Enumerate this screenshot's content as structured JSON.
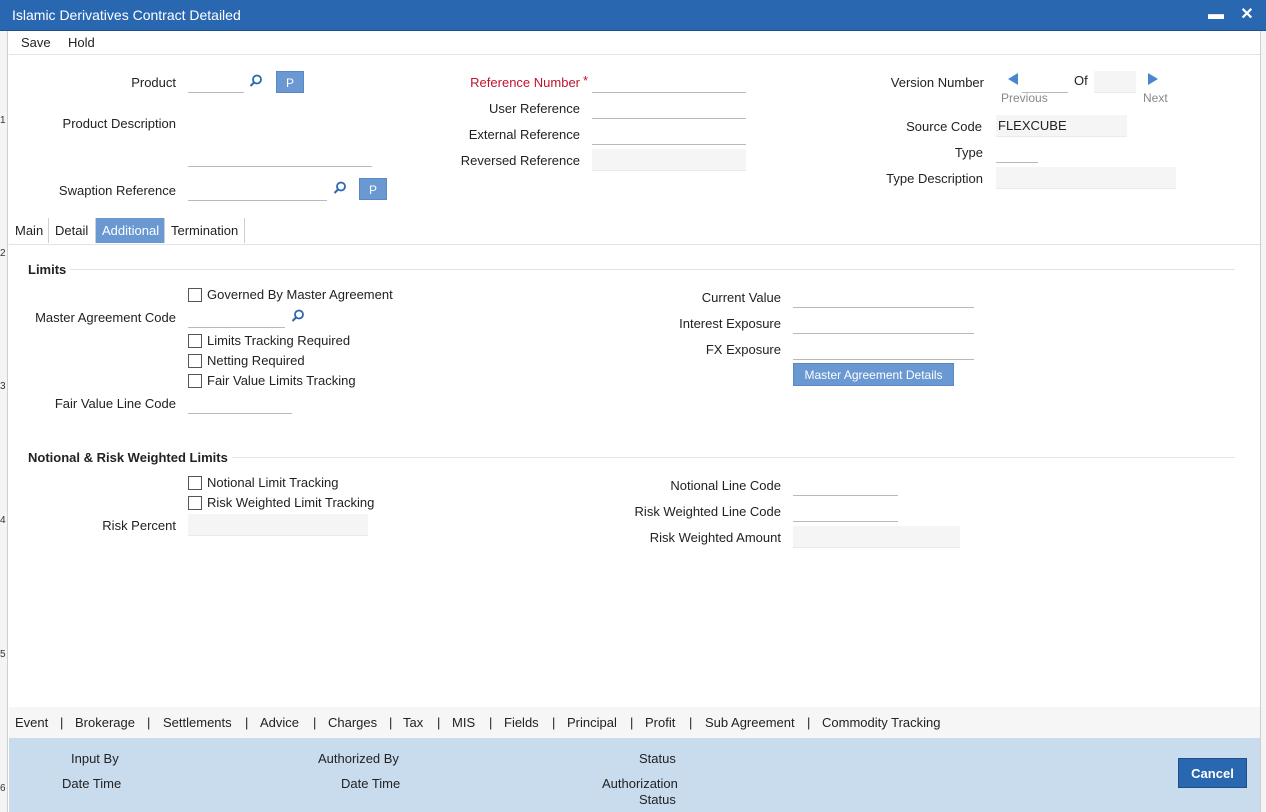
{
  "window": {
    "title": "Islamic Derivatives Contract Detailed"
  },
  "menu": {
    "save": "Save",
    "hold": "Hold"
  },
  "header": {
    "product_label": "Product",
    "product_description_label": "Product Description",
    "swaption_reference_label": "Swaption Reference",
    "p_button": "P",
    "reference_number_label": "Reference Number",
    "required_mark": "*",
    "user_reference_label": "User Reference",
    "external_reference_label": "External Reference",
    "reversed_reference_label": "Reversed Reference",
    "version_number_label": "Version Number",
    "of_label": "Of",
    "previous_label": "Previous",
    "next_label": "Next",
    "source_code_label": "Source Code",
    "source_code_value": "FLEXCUBE",
    "type_label": "Type",
    "type_description_label": "Type Description"
  },
  "tabs": [
    "Main",
    "Detail",
    "Additional",
    "Termination"
  ],
  "active_tab": "Additional",
  "limits": {
    "title": "Limits",
    "governed_by_master_agreement": "Governed By Master Agreement",
    "master_agreement_code_label": "Master Agreement Code",
    "limits_tracking_required": "Limits Tracking Required",
    "netting_required": "Netting Required",
    "fair_value_limits_tracking": "Fair Value Limits Tracking",
    "fair_value_line_code_label": "Fair Value Line Code",
    "current_value_label": "Current Value",
    "interest_exposure_label": "Interest Exposure",
    "fx_exposure_label": "FX Exposure",
    "master_agreement_details_button": "Master Agreement Details"
  },
  "notional": {
    "title": "Notional & Risk Weighted Limits",
    "notional_limit_tracking": "Notional Limit Tracking",
    "risk_weighted_limit_tracking": "Risk Weighted Limit Tracking",
    "risk_percent_label": "Risk Percent",
    "notional_line_code_label": "Notional Line Code",
    "risk_weighted_line_code_label": "Risk Weighted Line Code",
    "risk_weighted_amount_label": "Risk Weighted Amount"
  },
  "bottom_tabs": [
    "Event",
    "Brokerage",
    "Settlements",
    "Advice",
    "Charges",
    "Tax",
    "MIS",
    "Fields",
    "Principal",
    "Profit",
    "Sub Agreement",
    "Commodity Tracking"
  ],
  "footer": {
    "input_by": "Input By",
    "date_time": "Date Time",
    "authorized_by": "Authorized By",
    "status": "Status",
    "authorization": "Authorization",
    "authorization_status": "Status",
    "cancel": "Cancel"
  },
  "left_numbers": [
    "1",
    "2",
    "3",
    "4",
    "5",
    "6"
  ],
  "colors": {
    "titlebar": "#2a67b1",
    "accent_button": "#6a98d2",
    "required": "#c0142d",
    "footer_bg": "#c9dcee"
  }
}
